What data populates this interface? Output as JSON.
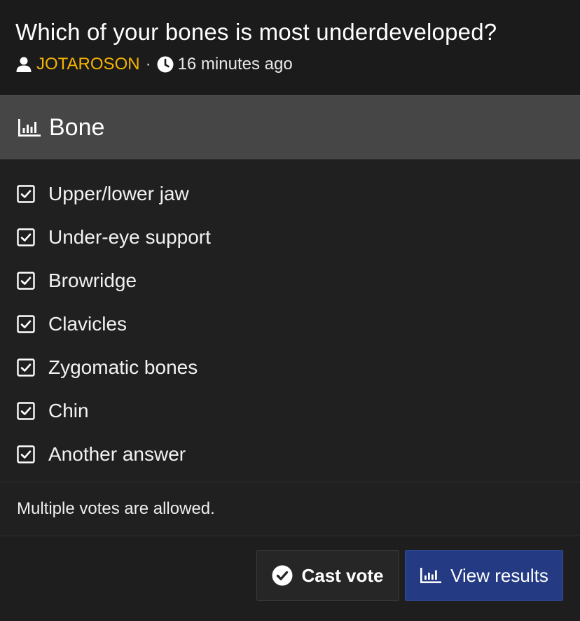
{
  "thread": {
    "title": "Which of your bones is most underdeveloped?",
    "author": "JOTAROSON",
    "separator": "·",
    "time": "16 minutes ago",
    "author_color": "#f5b301",
    "author_icon": "user-icon",
    "time_icon": "clock-icon"
  },
  "poll": {
    "title": "Bone",
    "title_icon": "bar-chart-icon",
    "options": [
      {
        "label": "Upper/lower jaw",
        "checked": true
      },
      {
        "label": "Under-eye support",
        "checked": true
      },
      {
        "label": "Browridge",
        "checked": true
      },
      {
        "label": "Clavicles",
        "checked": true
      },
      {
        "label": "Zygomatic bones",
        "checked": true
      },
      {
        "label": "Chin",
        "checked": true
      },
      {
        "label": "Another answer",
        "checked": true
      }
    ],
    "note": "Multiple votes are allowed."
  },
  "actions": {
    "cast_vote": "Cast vote",
    "cast_vote_icon": "check-circle-icon",
    "view_results": "View results",
    "view_results_icon": "bar-chart-icon",
    "primary_color": "#243b83"
  }
}
